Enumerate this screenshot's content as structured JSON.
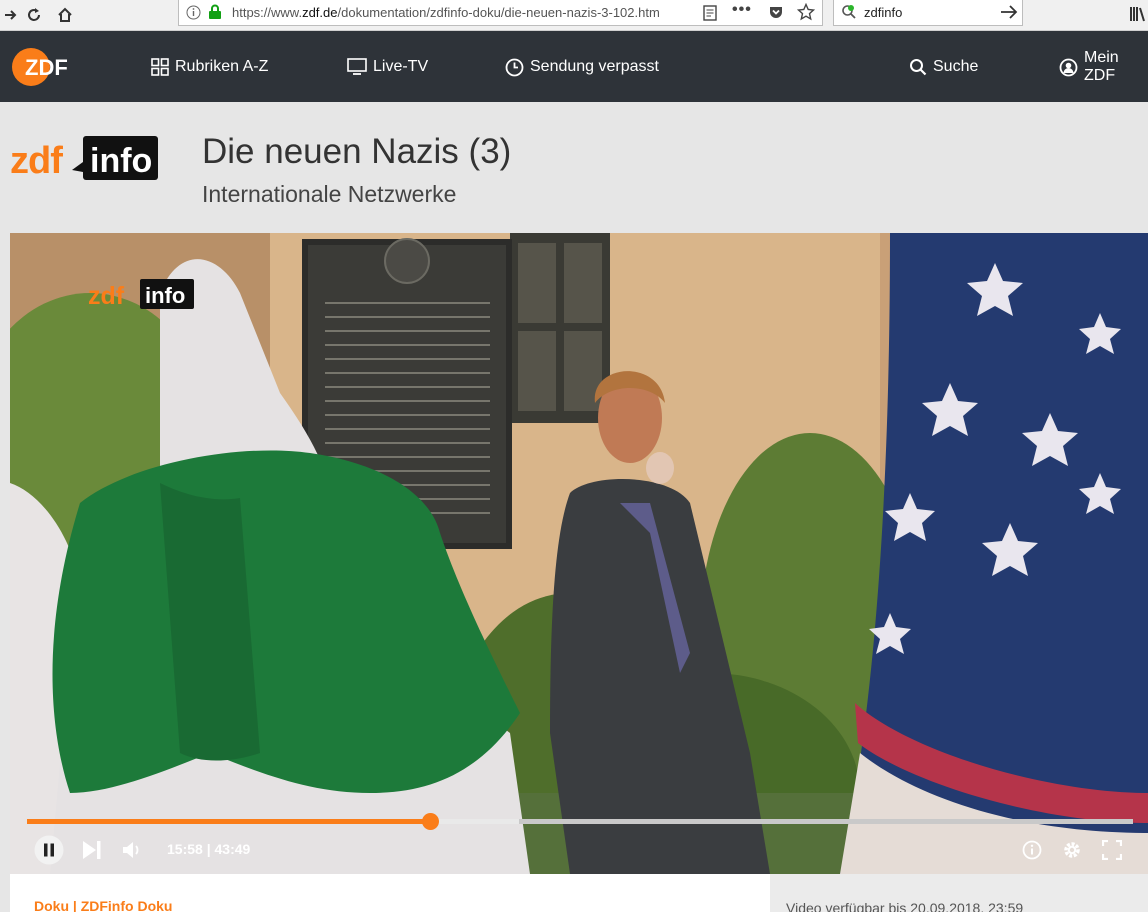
{
  "browser": {
    "url_prefix": "https://www.",
    "url_host": "zdf.de",
    "url_path": "/dokumentation/zdfinfo-doku/die-neuen-nazis-3-102.htm",
    "search_value": "zdfinfo"
  },
  "header": {
    "logo": "ZDF",
    "nav": {
      "rubriken": "Rubriken A-Z",
      "livetv": "Live-TV",
      "verpasst": "Sendung verpasst",
      "suche": "Suche",
      "mein": "Mein ZDF"
    }
  },
  "brand": {
    "part1": "zdf",
    "part2": "info"
  },
  "show": {
    "title": "Die neuen Nazis (3)",
    "subtitle": "Internationale Netzwerke"
  },
  "player": {
    "current_time": "15:58",
    "separator": "|",
    "duration": "43:49",
    "progress_fraction": 0.364,
    "buffer_fraction": 0.445,
    "watermark": {
      "part1": "zdf",
      "part2": "info"
    }
  },
  "meta": {
    "category": "Doku | ZDFinfo Doku",
    "availability": "Video verfügbar bis 20.09.2018, 23:59"
  },
  "colors": {
    "accent": "#fa7d19",
    "header_bg": "#2e3339",
    "page_bg": "#e6e6e6"
  }
}
